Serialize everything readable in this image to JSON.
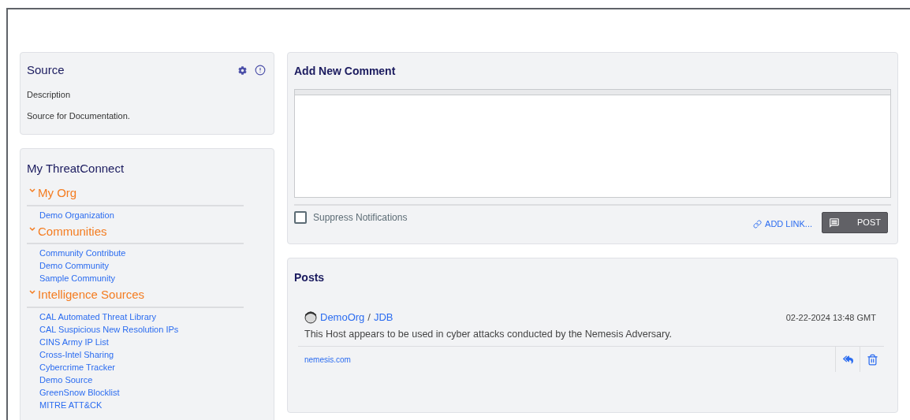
{
  "source": {
    "title": "Source",
    "description_label": "Description",
    "description": "Source for Documentation."
  },
  "my_threatconnect": {
    "title": "My ThreatConnect",
    "sections": [
      {
        "title": "My Org",
        "expanded": true,
        "items": [
          "Demo Organization"
        ]
      },
      {
        "title": "Communities",
        "expanded": true,
        "items": [
          "Community Contribute",
          "Demo Community",
          "Sample Community"
        ]
      },
      {
        "title": "Intelligence Sources",
        "expanded": true,
        "items": [
          "CAL Automated Threat Library",
          "CAL Suspicious New Resolution IPs",
          "CINS Army IP List",
          "Cross-Intel Sharing",
          "Cybercrime Tracker",
          "Demo Source",
          "GreenSnow Blocklist",
          "MITRE ATT&CK"
        ]
      }
    ]
  },
  "add_comment": {
    "title": "Add New Comment",
    "suppress_notifications": {
      "label": "Suppress Notifications",
      "checked": false
    },
    "add_link": "ADD LINK...",
    "post_button": "POST"
  },
  "posts": {
    "title": "Posts",
    "items": [
      {
        "org": "DemoOrg",
        "separator": "/",
        "user": "JDB",
        "time": "02-22-2024 13:48 GMT",
        "text": "This Host appears to be used in cyber attacks conducted by the Nemesis Adversary.",
        "link": "nemesis.com"
      }
    ]
  }
}
